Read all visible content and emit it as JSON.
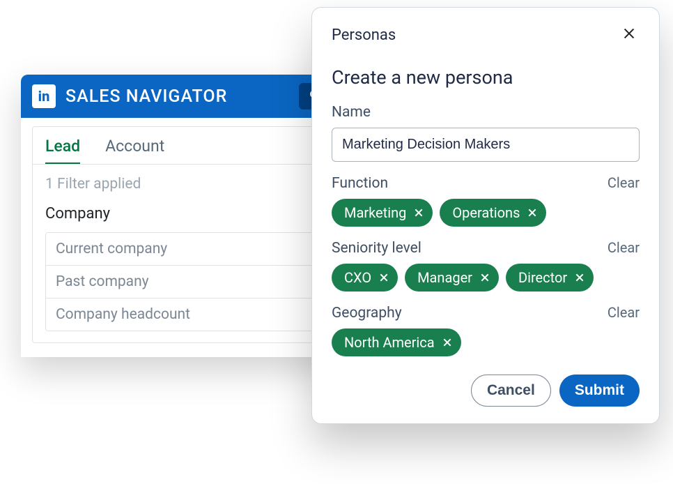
{
  "nav": {
    "title": "SALES NAVIGATOR",
    "logo_text": "in"
  },
  "tabs": {
    "lead": "Lead",
    "account": "Account"
  },
  "filters": {
    "applied_text": "1 Filter applied",
    "section_label": "Company",
    "items": [
      "Current company",
      "Past company",
      "Company headcount"
    ]
  },
  "modal": {
    "header": "Personas",
    "title": "Create a new persona",
    "name_label": "Name",
    "name_value": "Marketing Decision Makers",
    "function_label": "Function",
    "seniority_label": "Seniority level",
    "geography_label": "Geography",
    "clear": "Clear",
    "function_chips": [
      "Marketing",
      "Operations"
    ],
    "seniority_chips": [
      "CXO",
      "Manager",
      "Director"
    ],
    "geography_chips": [
      "North America"
    ],
    "cancel": "Cancel",
    "submit": "Submit"
  }
}
